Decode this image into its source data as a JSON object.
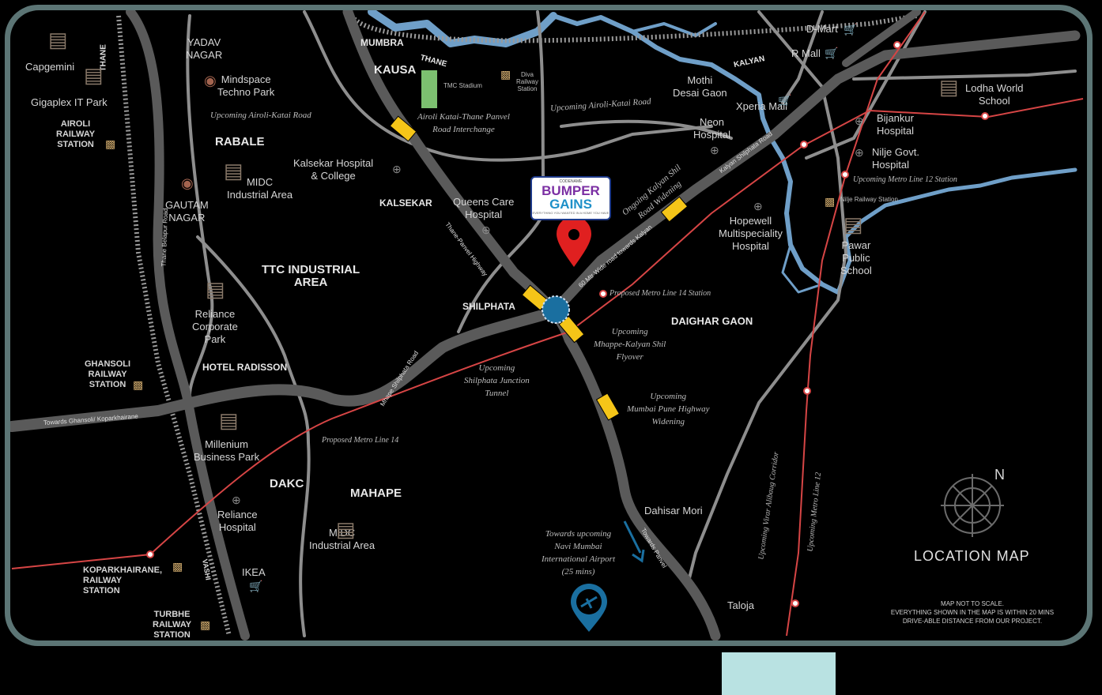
{
  "map": {
    "title": "LOCATION MAP",
    "north_label": "N",
    "disclaimer_line1": "MAP NOT TO SCALE.",
    "disclaimer_line2": "EVERYTHING SHOWN IN THE MAP IS WITHIN 20 MINS",
    "disclaimer_line3": "DRIVE-ABLE DISTANCE FROM OUR PROJECT.",
    "colors": {
      "road": "#8e8e8e",
      "highway": "#5a5a5a",
      "river": "#6f9fc8",
      "metro": "#d64545",
      "flyover": "#f5c518",
      "pin": "#e02020",
      "airport": "#1a6fa0"
    }
  },
  "logo": {
    "codename": "CODENAME",
    "line1": "BUMPER",
    "line2": "GAINS",
    "tagline": "EVERYTHING YOU WANTED IN A HOME YOU HAVE"
  },
  "places": {
    "yadav_nagar": "YADAV\nNAGAR",
    "thane": "THANE",
    "capgemini": "Capgemini",
    "gigaplex": "Gigaplex IT Park",
    "airoli_station": "AIROLI\nRAILWAY\nSTATION",
    "mindspace": "Mindspace\nTechno Park",
    "rabale": "RABALE",
    "midc_rabale": "MIDC\nIndustrial Area",
    "gautam_nagar": "GAUTAM\nNAGAR",
    "ttc": "TTC INDUSTRIAL\nAREA",
    "reliance_park": "Reliance\nCorporate\nPark",
    "hotel_radisson": "HOTEL RADISSON",
    "ghansoli": "GHANSOLI\nRAILWAY\nSTATION",
    "millenium": "Millenium\nBusiness Park",
    "dakc": "DAKC",
    "reliance_hospital": "Reliance\nHospital",
    "koparkhairane": "KOPARKHAIRANE,\nRAILWAY\nSTATION",
    "ikea": "IKEA",
    "turbhe": "TURBHE\nRAILWAY\nSTATION",
    "vashi": "VASHI",
    "mahape": "MAHAPE",
    "midc_mahape": "MIDC\nIndustrial Area",
    "mumbra": "MUMBRA",
    "thane2": "THANE",
    "kausa": "KAUSA",
    "tmc": "TMC Stadium",
    "diva": "Diva\nRailway\nStation",
    "kalsekar_hospital": "Kalsekar Hospital\n& College",
    "kalsekar": "KALSEKAR",
    "queens": "Queens Care\nHospital",
    "shilphata": "SHILPHATA",
    "mothi": "Mothi\nDesai Gaon",
    "neon": "Neon\nHospital",
    "kalyan": "KALYAN",
    "dmart": "D-Mart",
    "rmall": "R Mall",
    "xperia": "Xperia Mall",
    "lodha": "Lodha World\nSchool",
    "bijankur": "Bijankur\nHospital",
    "nilje_hosp": "Nilje Govt.\nHospital",
    "nilje_station": "Nilje Railway\nStation",
    "hopewell": "Hopewell\nMultispeciality\nHospital",
    "pawar": "Pawar\nPublic\nSchool",
    "daighar": "DAIGHAR GAON",
    "dahisar": "Dahisar Mori",
    "taloja": "Taloja"
  },
  "annotations": {
    "airoli_katai": "Upcoming Airoli-Katai Road",
    "airoli_katai_2": "Upcoming Airoli-Katai Road",
    "interchange": "Airoli Katai-Thane Panvel\nRoad Interchange",
    "kalyan_shil_widening": "Ongoing Kalyan Shil\nRoad Widening",
    "metro12_station": "Upcoming Metro Line 12 Station",
    "metro14_station": "Proposed Metro Line 14 Station",
    "flyover": "Upcoming\nMhappe-Kalyan Shil\nFlyover",
    "tunnel": "Upcoming\nShilphata Junction\nTunnel",
    "highway_widening": "Upcoming\nMumbai Pune Highway\nWidening",
    "metro14": "Proposed Metro Line 14",
    "airport": "Towards upcoming\nNavi Mumbai\nInternational Airport\n(25 mins)",
    "virar_alibaug": "Upcoming Virar Alibaug Corridor",
    "metro12": "Upcoming Metro Line 12"
  },
  "roads": {
    "thane_belapur": "Thane Belapur Road",
    "towards_ghansoli": "Towards Ghansoli/ Koparkhairane",
    "mhape_shilphata": "Mhape Shilphata Road",
    "thane_panvel": "Thane-Panvel Highway",
    "sixty_mtr": "60 Mtr Wide road towards Kalyan",
    "kalyan_shilphata": "Kalyan Shilphata Road",
    "towards_panvel": "Towards Panvel"
  }
}
